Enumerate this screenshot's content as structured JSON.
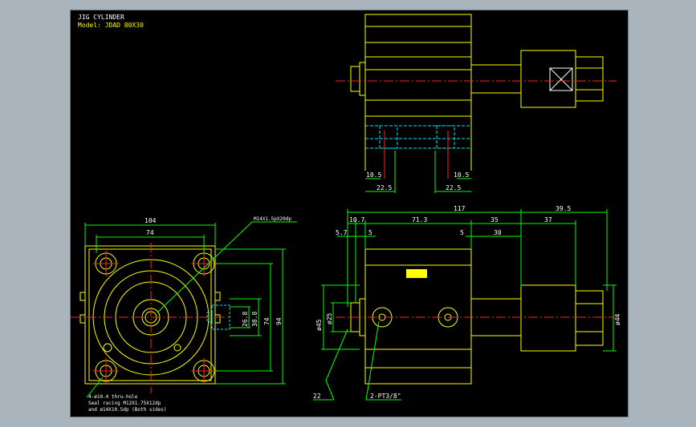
{
  "title": {
    "name": "JIG CYLINDER",
    "model": "Model: JDAD 80X30"
  },
  "colors": {
    "background": "#000000",
    "frame": "#a9b4bd",
    "geometry": "#ffff00",
    "dimension": "#00ff00",
    "centerline": "#ff2222",
    "hidden": "#00e5ff",
    "label": "#ffffff"
  },
  "top_view": {
    "dims": {
      "left_a": "10.5",
      "right_a": "10.5",
      "left_b": "22.5",
      "right_b": "22.5"
    }
  },
  "front_view": {
    "dims": {
      "width": "104",
      "bolt_pitch_h": "74",
      "bolt_pitch_v": "74",
      "height": "94",
      "port_a": "26.8",
      "port_b": "38.8"
    },
    "callouts": {
      "top_thread": "M14X1.5pX20dp",
      "holes_line1": "4-ø10.4 thru-hole",
      "holes_line2": "Seal racing M12X1.75X12dp",
      "holes_line3": "and ø14X10.5dp (Both sides)"
    }
  },
  "side_view": {
    "dims": {
      "overall": "117",
      "rod_ext": "39.5",
      "d10_7": "10.7",
      "d71_3": "71.3",
      "d35": "35",
      "d5_7": "5.7",
      "d5a": "5",
      "d5b": "5",
      "d30": "30",
      "d37": "37",
      "d22": "22",
      "bore": "ø45",
      "rod": "ø25",
      "tip": "ø44"
    },
    "callouts": {
      "ports": "2-PT3/8\""
    }
  }
}
